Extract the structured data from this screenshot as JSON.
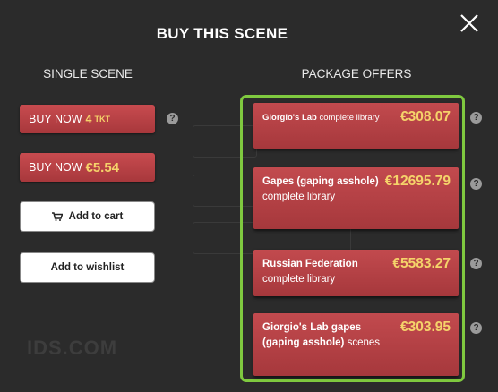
{
  "title": "BUY THIS SCENE",
  "single": {
    "heading": "SINGLE SCENE",
    "buy_tokens": {
      "prefix": "BUY NOW",
      "amount": "4",
      "unit": "TKT"
    },
    "buy_euro": {
      "prefix": "BUY NOW",
      "amount": "€5.54"
    },
    "add_cart": "Add to cart",
    "add_wishlist": "Add to wishlist",
    "help": "?"
  },
  "package": {
    "heading": "PACKAGE OFFERS",
    "offers": [
      {
        "name_bold": "Giorgio's Lab",
        "name_rest": " complete library",
        "price": "€308.07"
      },
      {
        "name_bold": "Gapes (gaping asshole)",
        "name_rest": " complete library",
        "price": "€12695.79"
      },
      {
        "name_bold": "Russian Federation",
        "name_rest": " complete library",
        "price": "€5583.27"
      },
      {
        "name_bold": "Giorgio's Lab gapes (gaping asshole)",
        "name_rest": " scenes",
        "price": "€303.95"
      }
    ],
    "help": "?"
  },
  "background_watermark": "IDS.COM",
  "icons": {
    "close": "close-icon",
    "cart": "cart-icon",
    "help": "help-icon"
  },
  "colors": {
    "accent_green": "#7fc93f",
    "button_red": "#b8414a",
    "price_gold": "#f5d36a"
  }
}
